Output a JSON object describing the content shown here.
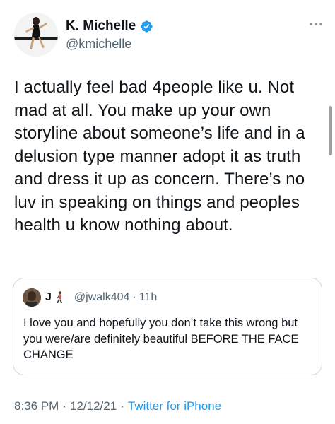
{
  "author": {
    "display_name": "K. Michelle",
    "handle": "@kmichelle",
    "verified_icon": "verified-badge-icon",
    "verified_color": "#1d9bf0"
  },
  "tweet": {
    "text": "I actually feel bad 4people like u. Not mad at all. You make up your own storyline about someone’s life and in a delusion type manner adopt it as truth and dress it up as concern. There’s no luv in speaking on things and peoples health u know nothing about."
  },
  "quoted_tweet": {
    "name": "J",
    "name_icon": "person-walking-emoji-icon",
    "handle": "@jwalk404",
    "separator": "·",
    "time": "11h",
    "text": "I love you and hopefully you don’t take this wrong but you were/are definitely beautiful BEFORE THE FACE CHANGE"
  },
  "meta": {
    "time": "8:36 PM",
    "separator1": "·",
    "date": "12/12/21",
    "separator2": "·",
    "source": "Twitter for iPhone"
  },
  "colors": {
    "text_primary": "#0f1419",
    "text_secondary": "#536471",
    "link": "#1d9bf0",
    "border": "#cfd9de"
  }
}
